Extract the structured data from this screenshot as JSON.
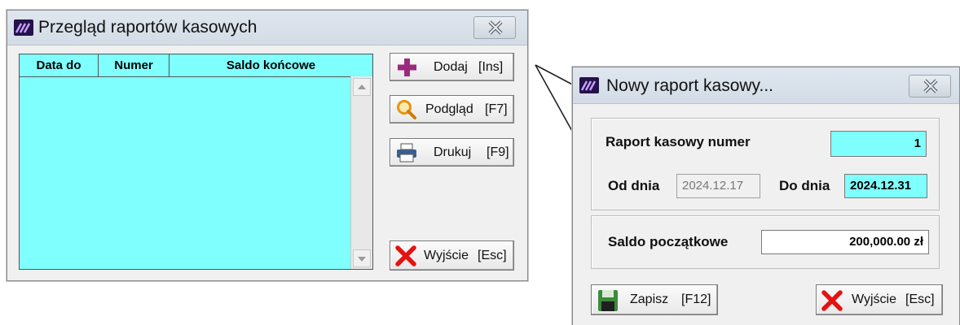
{
  "left_window": {
    "title": "Przegląd raportów kasowych",
    "columns": [
      "Data do",
      "Numer",
      "Saldo końcowe"
    ],
    "rows": [],
    "buttons": {
      "add": {
        "label": "Dodaj",
        "key": "[Ins]",
        "icon": "plus-icon"
      },
      "preview": {
        "label": "Podgląd",
        "key": "[F7]",
        "icon": "magnifier-icon"
      },
      "print": {
        "label": "Drukuj",
        "key": "[F9]",
        "icon": "printer-icon"
      },
      "exit": {
        "label": "Wyjście",
        "key": "[Esc]",
        "icon": "red-x-icon"
      }
    }
  },
  "right_window": {
    "title": "Nowy raport kasowy...",
    "report_number_label": "Raport kasowy numer",
    "report_number": "1",
    "from_label": "Od dnia",
    "from_date": "2024.12.17",
    "to_label": "Do dnia",
    "to_date": "2024.12.31",
    "opening_balance_label": "Saldo początkowe",
    "opening_balance": "200,000.00 zł",
    "buttons": {
      "save": {
        "label": "Zapisz",
        "key": "[F12]",
        "icon": "floppy-disk-icon"
      },
      "exit": {
        "label": "Wyjście",
        "key": "[Esc]",
        "icon": "red-x-icon"
      }
    }
  },
  "colors": {
    "grid_bg": "#80ffff",
    "field_highlight": "#80ffff",
    "plus": "#9b2a7c",
    "exit_x": "#e51212"
  }
}
